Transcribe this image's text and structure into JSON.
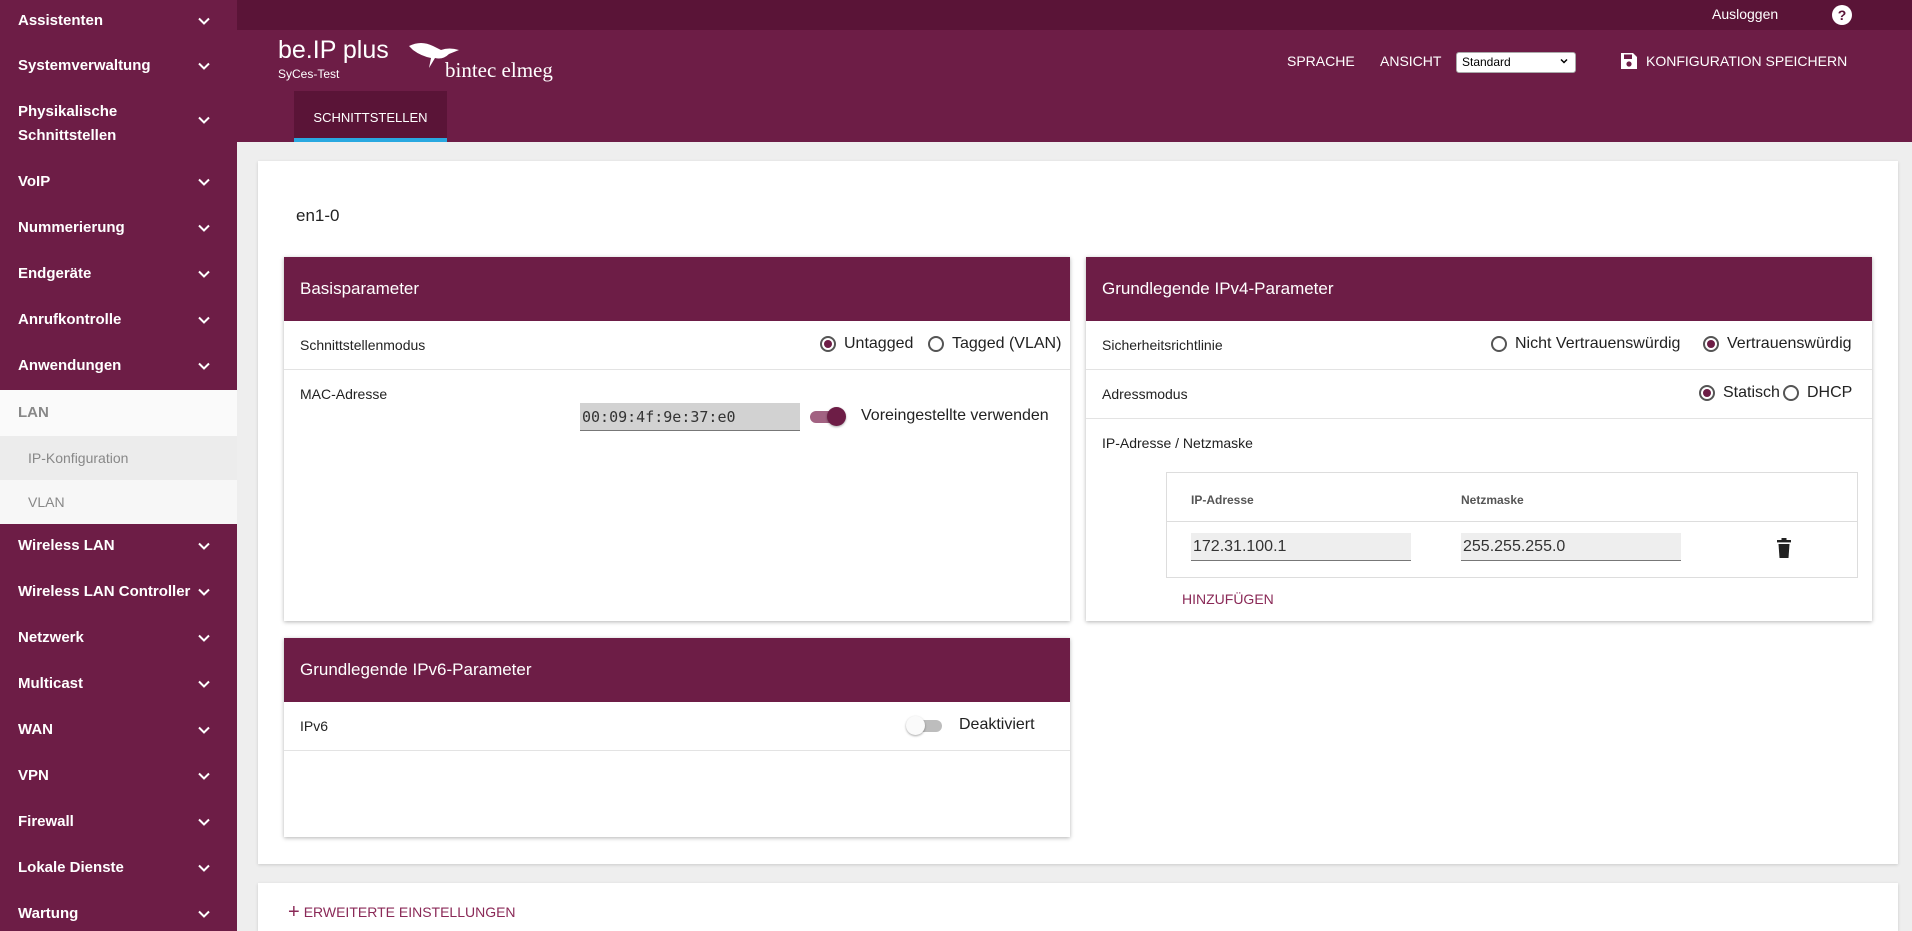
{
  "sidebar": {
    "items": [
      {
        "label": "Assistenten"
      },
      {
        "label": "Systemverwaltung"
      },
      {
        "label": "Physikalische Schnittstellen"
      },
      {
        "label": "VoIP"
      },
      {
        "label": "Nummerierung"
      },
      {
        "label": "Endgeräte"
      },
      {
        "label": "Anrufkontrolle"
      },
      {
        "label": "Anwendungen"
      }
    ],
    "expanded": {
      "label": "LAN",
      "children": [
        {
          "label": "IP-Konfiguration",
          "active": true
        },
        {
          "label": "VLAN",
          "active": false
        }
      ]
    },
    "items_after": [
      {
        "label": "Wireless LAN"
      },
      {
        "label": "Wireless LAN Controller"
      },
      {
        "label": "Netzwerk"
      },
      {
        "label": "Multicast"
      },
      {
        "label": "WAN"
      },
      {
        "label": "VPN"
      },
      {
        "label": "Firewall"
      },
      {
        "label": "Lokale Dienste"
      },
      {
        "label": "Wartung"
      }
    ]
  },
  "topbar": {
    "logout_label": "Ausloggen",
    "help_icon": "question-mark-icon",
    "help_glyph": "?"
  },
  "header": {
    "product": "be.IP plus",
    "device": "SyCes-Test",
    "brand": "bintec elmeg",
    "language_label": "SPRACHE",
    "view_label": "ANSICHT",
    "view_value": "Standard",
    "save_label": "KONFIGURATION SPEICHERN",
    "tab_label": "SCHNITTSTELLEN"
  },
  "main": {
    "interface_name": "en1-0",
    "basis": {
      "title": "Basisparameter",
      "mode_label": "Schnittstellenmodus",
      "mode_options": [
        "Untagged",
        "Tagged (VLAN)"
      ],
      "mode_selected": "Untagged",
      "mac_label": "MAC-Adresse",
      "mac_value": "00:09:4f:9e:37:e0",
      "mac_default_label": "Voreingestellte verwenden",
      "mac_default_on": true
    },
    "ipv6": {
      "title": "Grundlegende IPv6-Parameter",
      "label": "IPv6",
      "state_label": "Deaktiviert",
      "on": false
    },
    "ipv4": {
      "title": "Grundlegende IPv4-Parameter",
      "security_label": "Sicherheitsrichtlinie",
      "security_options": [
        "Nicht Vertrauenswürdig",
        "Vertrauenswürdig"
      ],
      "security_selected": "Vertrauenswürdig",
      "address_mode_label": "Adressmodus",
      "address_mode_options": [
        "Statisch",
        "DHCP"
      ],
      "address_mode_selected": "Statisch",
      "ip_mask_label": "IP-Adresse / Netzmaske",
      "table_headers": [
        "IP-Adresse",
        "Netzmaske"
      ],
      "rows": [
        {
          "ip": "172.31.100.1",
          "mask": "255.255.255.0"
        }
      ],
      "add_label": "HINZUFÜGEN"
    },
    "advanced_label": "ERWEITERTE EINSTELLUNGEN"
  },
  "colors": {
    "primary": "#6d1d46",
    "primary_dark": "#5a1437",
    "tab_indicator": "#29a8e0",
    "link": "#8a2957"
  }
}
